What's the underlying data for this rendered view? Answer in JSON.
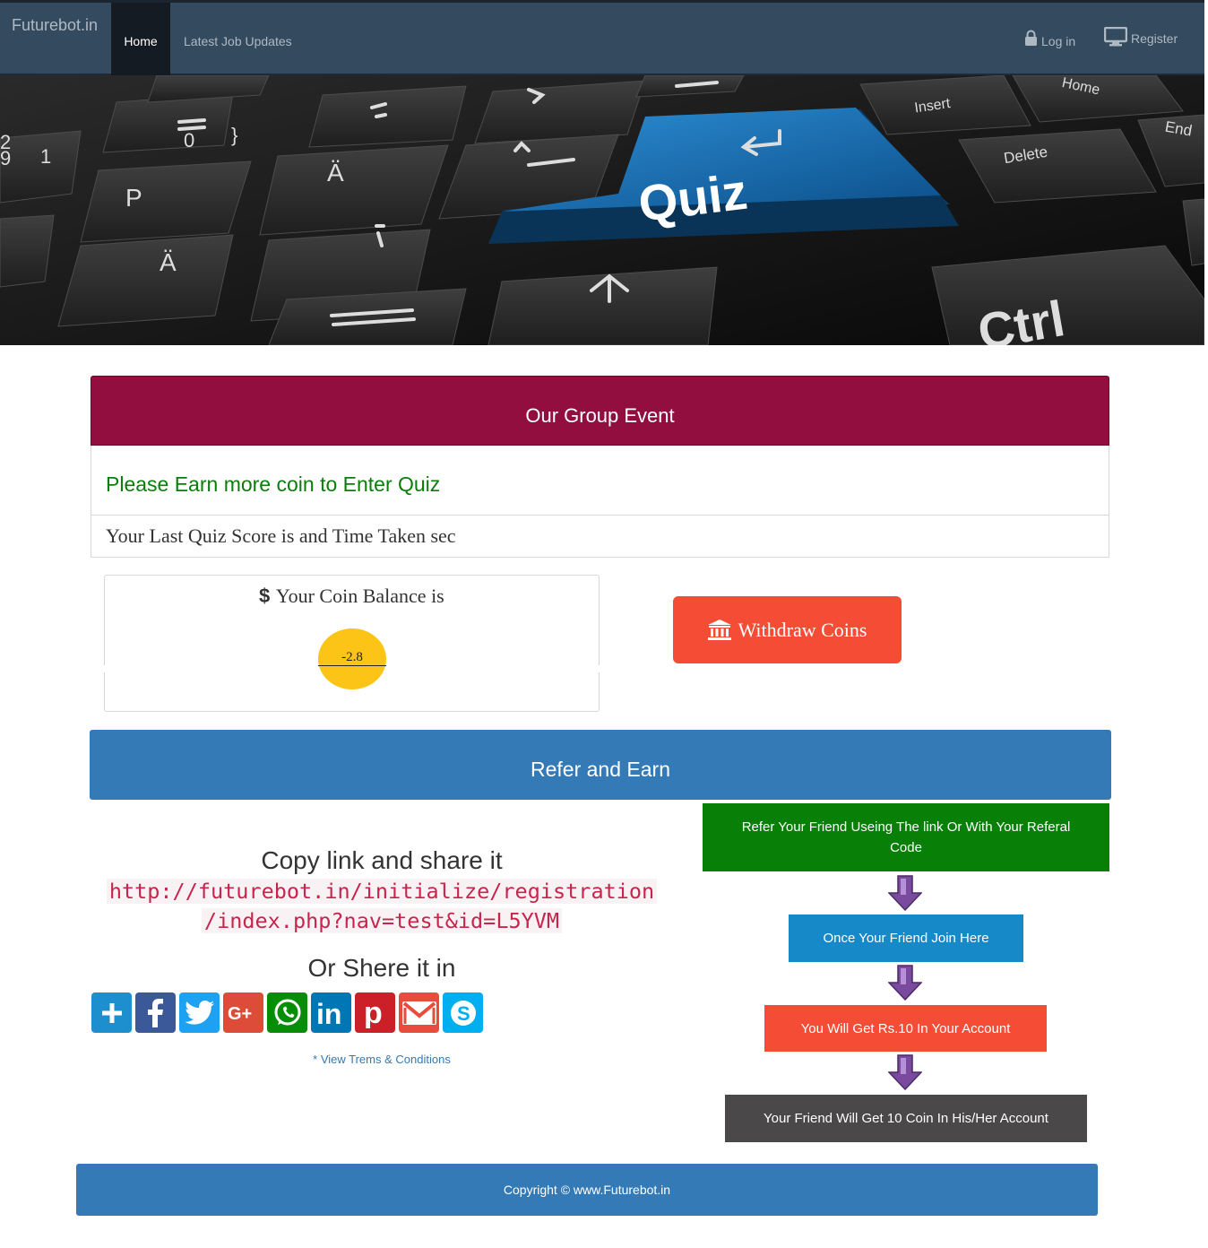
{
  "navbar": {
    "brand": "Futurebot.in",
    "home": "Home",
    "latest_jobs": "Latest Job Updates",
    "login": "Log in",
    "register": "Register"
  },
  "hero": {
    "keys": {
      "quiz": "Quiz",
      "ctrl": "Ctrl",
      "delete": "Delete",
      "insert": "Insert",
      "home": "Home",
      "end": "End",
      "p": "P",
      "a_umlaut": "Ä",
      "a_umlaut_small": "Ä"
    }
  },
  "group_event": {
    "title": "Our Group Event",
    "message": "Please Earn more coin to Enter Quiz",
    "last_score": "Your Last Quiz Score is and Time Taken sec"
  },
  "coins": {
    "balance_label": "Your Coin Balance is",
    "balance_value": "-2.8",
    "withdraw_label": "Withdraw Coins"
  },
  "refer": {
    "title": "Refer and Earn",
    "copy_title": "Copy link and share it",
    "link_line1": "http://futurebot.in/initialize/registration",
    "link_line2": "/index.php?nav=test&id=L5YVM",
    "share_title": "Or Shere it in",
    "share_buttons": [
      "addthis",
      "facebook",
      "twitter",
      "google-plus",
      "whatsapp",
      "linkedin",
      "pinterest",
      "gmail",
      "skype"
    ],
    "terms": "* View Trems & Conditions",
    "steps": [
      "Refer Your Friend Useing The link Or With Your Referal Code",
      "Once Your Friend Join Here",
      "You Will Get Rs.10 In Your Account",
      "Your Friend Will Get 10 Coin In His/Her Account"
    ]
  },
  "footer": {
    "copyright": "Copyright © www.Futurebot.in"
  },
  "colors": {
    "navbar": "#334a5f",
    "event_header": "#920e3f",
    "refer_header": "#337ab7",
    "withdraw": "#f54c36",
    "coin": "#fbc417",
    "step1": "#088008",
    "step2": "#1689c8",
    "step3": "#f54c36",
    "step4": "#4a4849"
  }
}
